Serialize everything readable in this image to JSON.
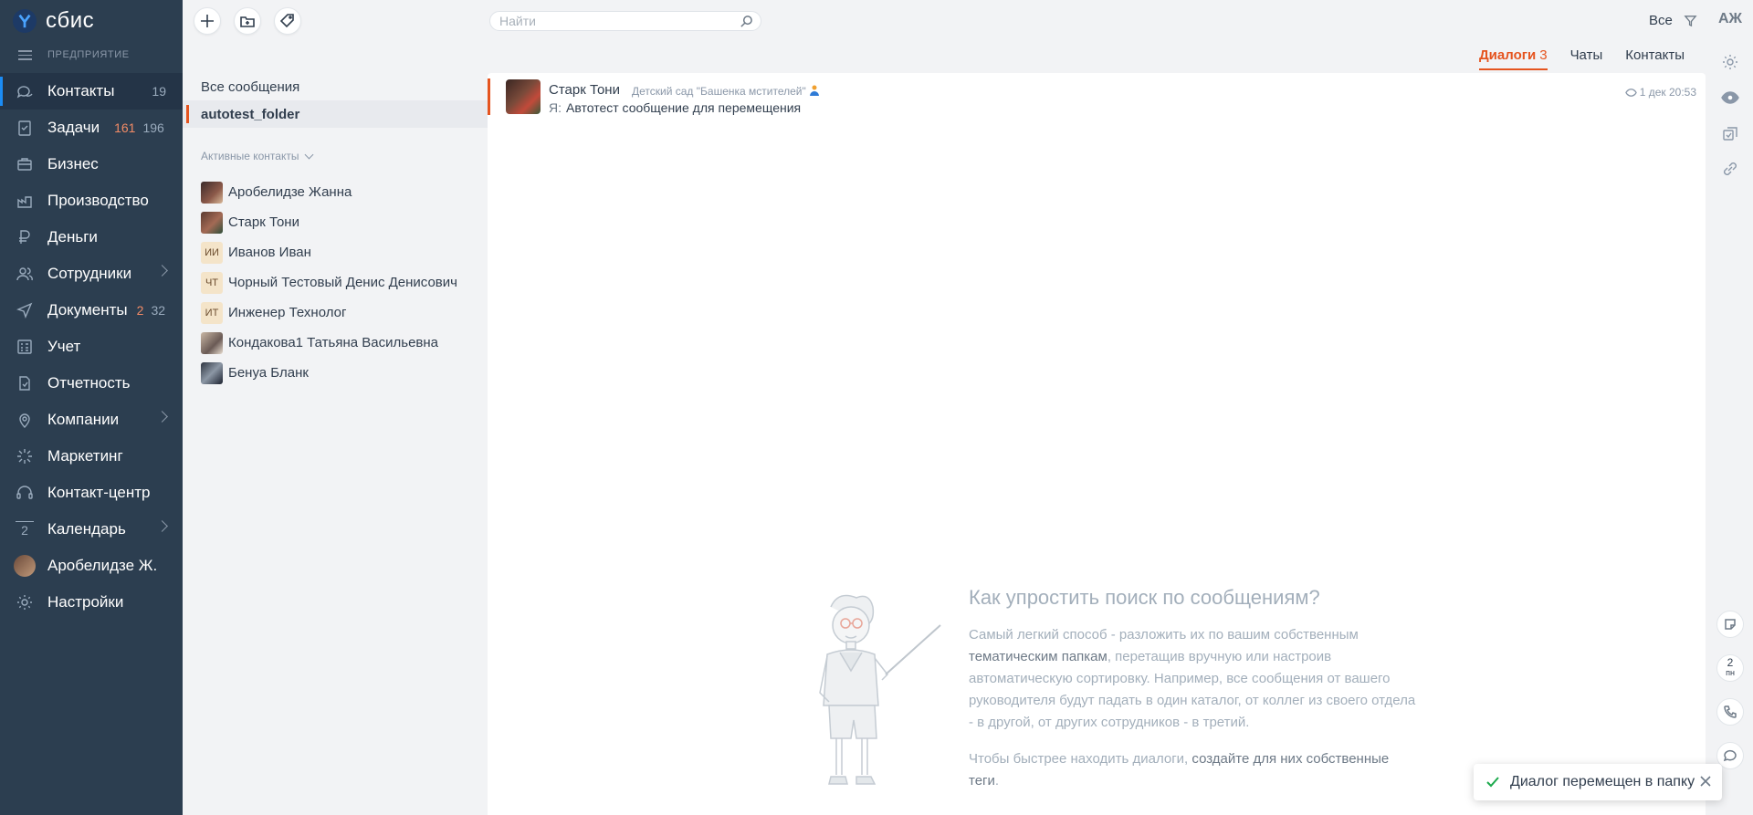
{
  "app": {
    "logo_text": "сбис",
    "company": "ПРЕДПРИЯТИЕ",
    "user_initials": "АЖ"
  },
  "sidebar": {
    "items": [
      {
        "label": "Контакты",
        "counts": [
          "19"
        ],
        "icon": "contacts-icon",
        "active": true
      },
      {
        "label": "Задачи",
        "counts_red": "161",
        "counts": [
          "196"
        ],
        "icon": "tasks-icon"
      },
      {
        "label": "Бизнес",
        "icon": "business-icon"
      },
      {
        "label": "Производство",
        "icon": "production-icon"
      },
      {
        "label": "Деньги",
        "icon": "money-icon"
      },
      {
        "label": "Сотрудники",
        "icon": "employees-icon",
        "arrow": true
      },
      {
        "label": "Документы",
        "counts_red": "2",
        "counts": [
          "32"
        ],
        "icon": "documents-icon"
      },
      {
        "label": "Учет",
        "icon": "accounting-icon"
      },
      {
        "label": "Отчетность",
        "icon": "reports-icon"
      },
      {
        "label": "Компании",
        "icon": "companies-icon",
        "arrow": true
      },
      {
        "label": "Маркетинг",
        "icon": "marketing-icon"
      },
      {
        "label": "Контакт-центр",
        "icon": "contact-center-icon"
      },
      {
        "label": "Календарь",
        "icon": "calendar-icon",
        "arrow": true,
        "calendar_day": "2"
      },
      {
        "label": "Аробелидзе Ж.",
        "icon": "user-avatar"
      },
      {
        "label": "Настройки",
        "icon": "settings-icon"
      }
    ]
  },
  "search": {
    "placeholder": "Найти"
  },
  "filter": {
    "label": "Все"
  },
  "tabs": [
    {
      "label": "Диалоги",
      "count": "3",
      "active": true
    },
    {
      "label": "Чаты"
    },
    {
      "label": "Контакты"
    }
  ],
  "folders": {
    "items": [
      {
        "label": "Все сообщения"
      },
      {
        "label": "autotest_folder",
        "selected": true
      }
    ],
    "section_title": "Активные контакты",
    "contacts": [
      {
        "name": "Аробелидзе Жанна",
        "avatar": "photo"
      },
      {
        "name": "Старк Тони",
        "avatar": "photo"
      },
      {
        "name": "Иванов Иван",
        "avatar": "ИИ"
      },
      {
        "name": "Чорный Тестовый Денис Денисович",
        "avatar": "ЧТ"
      },
      {
        "name": "Инженер Технолог",
        "avatar": "ИТ"
      },
      {
        "name": "Кондакова1 Татьяна Васильевна",
        "avatar": "photo"
      },
      {
        "name": "Бенуа Бланк",
        "avatar": "photo"
      }
    ]
  },
  "message": {
    "sender": "Старк Тони",
    "org": "Детский сад \"Башенка мстителей\"",
    "prefix": "Я:",
    "text": "Автотест сообщение для перемещения",
    "date": "1 дек 20:53"
  },
  "hint": {
    "title": "Как упростить поиск по сообщениям?",
    "p1_a": "Самый легкий способ - разложить их по вашим собственным ",
    "p1_link": "тематическим папкам",
    "p1_b": ", перетащив вручную или настроив автоматическую сортировку. Например, все сообщения от вашего руководителя будут падать в один каталог, от коллег из своего отдела - в другой, от других сотрудников - в третий.",
    "p2_a": "Чтобы быстрее находить диалоги, ",
    "p2_link": "создайте для них собственные теги",
    "p2_b": "."
  },
  "right_panel": {
    "date_day": "2",
    "date_weekday": "пн"
  },
  "toast": {
    "text": "Диалог перемещен в папку"
  },
  "colors": {
    "accent": "#e5541f",
    "sidebar": "#2c3e50",
    "success": "#1ba94c"
  }
}
